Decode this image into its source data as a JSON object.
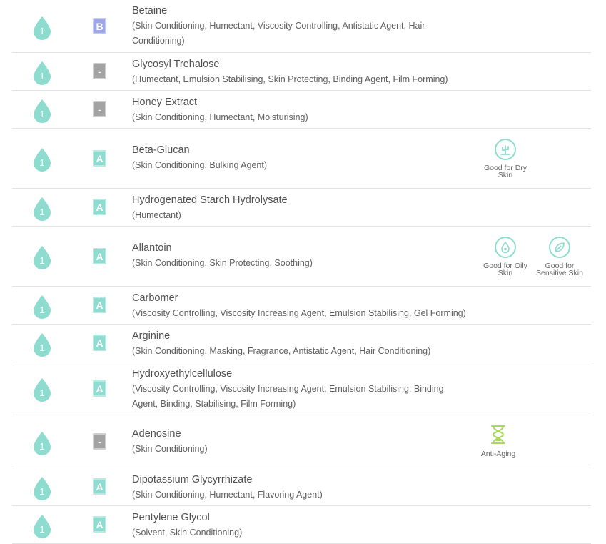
{
  "colors": {
    "safety_drop": "#8edccf",
    "grade_a": "#8edccf",
    "grade_b": "#9ea6ea",
    "grade_none": "#a3a3a3",
    "badge_teal": "#8edccf",
    "badge_green": "#a8d95f"
  },
  "ingredients": [
    {
      "score": "1",
      "grade": "B",
      "name": "Betaine",
      "functions": "(Skin Conditioning, Humectant, Viscosity Controlling, Antistatic Agent, Hair Conditioning)"
    },
    {
      "score": "1",
      "grade": "-",
      "name": "Glycosyl Trehalose",
      "functions": "(Humectant, Emulsion Stabilising, Skin Protecting, Binding Agent, Film Forming)"
    },
    {
      "score": "1",
      "grade": "-",
      "name": "Honey Extract",
      "functions": "(Skin Conditioning, Humectant, Moisturising)"
    },
    {
      "score": "1",
      "grade": "A",
      "name": "Beta-Glucan",
      "functions": "(Skin Conditioning, Bulking Agent)",
      "badges": [
        {
          "icon": "cactus-icon",
          "label": "Good for Dry Skin"
        }
      ]
    },
    {
      "score": "1",
      "grade": "A",
      "name": "Hydrogenated Starch Hydrolysate",
      "functions": "(Humectant)"
    },
    {
      "score": "1",
      "grade": "A",
      "name": "Allantoin",
      "functions": "(Skin Conditioning, Skin Protecting, Soothing)",
      "badges": [
        {
          "icon": "oil-drop-icon",
          "label": "Good for Oily Skin"
        },
        {
          "icon": "leaf-icon",
          "label": "Good for Sensitive Skin"
        }
      ]
    },
    {
      "score": "1",
      "grade": "A",
      "name": "Carbomer",
      "functions": "(Viscosity Controlling, Viscosity Increasing Agent, Emulsion Stabilising, Gel Forming)"
    },
    {
      "score": "1",
      "grade": "A",
      "name": "Arginine",
      "functions": "(Skin Conditioning, Masking, Fragrance, Antistatic Agent, Hair Conditioning)"
    },
    {
      "score": "1",
      "grade": "A",
      "name": "Hydroxyethylcellulose",
      "functions": "(Viscosity Controlling, Viscosity Increasing Agent, Emulsion Stabilising, Binding Agent, Binding, Stabilising, Film Forming)"
    },
    {
      "score": "1",
      "grade": "-",
      "name": "Adenosine",
      "functions": "(Skin Conditioning)",
      "badges": [
        {
          "icon": "hourglass-icon",
          "label": "Anti-Aging"
        }
      ]
    },
    {
      "score": "1",
      "grade": "A",
      "name": "Dipotassium Glycyrrhizate",
      "functions": "(Skin Conditioning, Humectant, Flavoring Agent)"
    },
    {
      "score": "1",
      "grade": "A",
      "name": "Pentylene Glycol",
      "functions": "(Solvent, Skin Conditioning)"
    }
  ]
}
